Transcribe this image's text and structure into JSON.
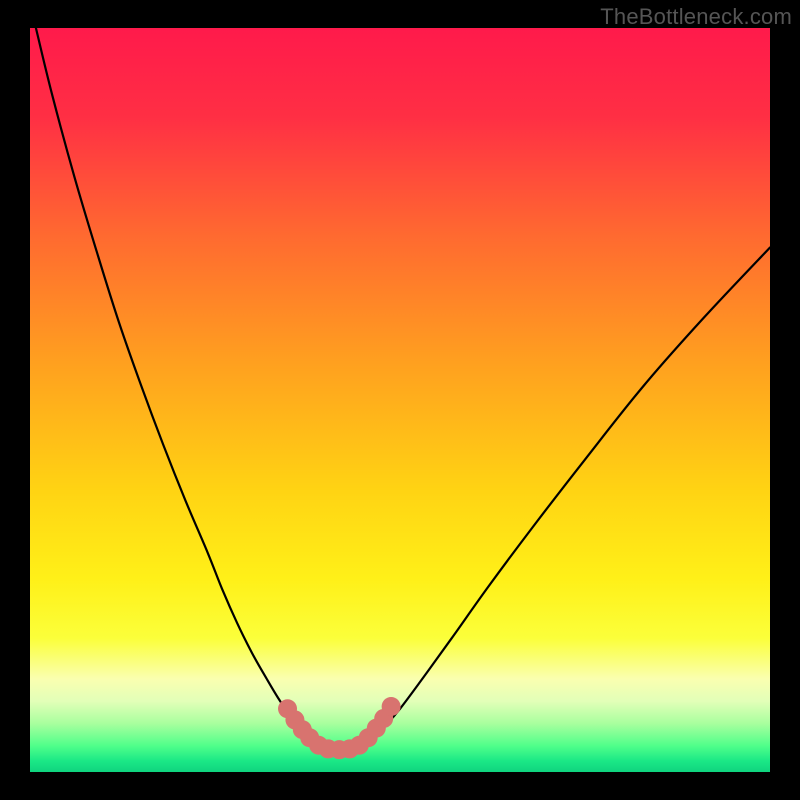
{
  "watermark": "TheBottleneck.com",
  "chart_data": {
    "type": "line",
    "title": "",
    "xlabel": "",
    "ylabel": "",
    "xlim": [
      0,
      100
    ],
    "ylim": [
      0,
      100
    ],
    "series": [
      {
        "name": "left-curve",
        "x": [
          0.8,
          3,
          6,
          9,
          12,
          15,
          18,
          21,
          24,
          26,
          28,
          30,
          32,
          33.5,
          35,
          36.5,
          37.8
        ],
        "y": [
          100,
          91,
          80,
          70,
          60.5,
          52,
          44,
          36.5,
          29.5,
          24.5,
          20,
          16,
          12.5,
          10,
          7.8,
          6,
          4.7
        ]
      },
      {
        "name": "right-curve",
        "x": [
          46.5,
          48,
          50,
          53,
          57,
          62,
          68,
          75,
          83,
          91,
          100
        ],
        "y": [
          4.7,
          6.2,
          8.5,
          12.5,
          18,
          25,
          33,
          42,
          52,
          61,
          70.5
        ]
      },
      {
        "name": "flat-bottom",
        "x": [
          37.8,
          39,
          41,
          43,
          45,
          46.5
        ],
        "y": [
          4.7,
          3.6,
          3.0,
          3.0,
          3.6,
          4.7
        ]
      }
    ],
    "highlight": {
      "name": "marker-band",
      "color": "#d8736f",
      "points": [
        [
          34.8,
          8.5
        ],
        [
          35.8,
          7.0
        ],
        [
          36.8,
          5.7
        ],
        [
          37.8,
          4.6
        ],
        [
          39.0,
          3.6
        ],
        [
          40.3,
          3.1
        ],
        [
          41.8,
          3.0
        ],
        [
          43.2,
          3.1
        ],
        [
          44.5,
          3.6
        ],
        [
          45.7,
          4.6
        ],
        [
          46.8,
          5.9
        ],
        [
          47.8,
          7.2
        ],
        [
          48.8,
          8.8
        ]
      ]
    },
    "background": {
      "type": "vertical-gradient",
      "stops": [
        {
          "offset": 0.0,
          "color": "#ff1a4b"
        },
        {
          "offset": 0.12,
          "color": "#ff2f44"
        },
        {
          "offset": 0.28,
          "color": "#ff6a30"
        },
        {
          "offset": 0.45,
          "color": "#ffa01f"
        },
        {
          "offset": 0.62,
          "color": "#ffd313"
        },
        {
          "offset": 0.74,
          "color": "#fff018"
        },
        {
          "offset": 0.82,
          "color": "#fbff3a"
        },
        {
          "offset": 0.875,
          "color": "#faffb0"
        },
        {
          "offset": 0.905,
          "color": "#e2ffb8"
        },
        {
          "offset": 0.935,
          "color": "#a8ff9e"
        },
        {
          "offset": 0.965,
          "color": "#4fff8a"
        },
        {
          "offset": 0.985,
          "color": "#1be886"
        },
        {
          "offset": 1.0,
          "color": "#0fd47f"
        }
      ]
    }
  }
}
